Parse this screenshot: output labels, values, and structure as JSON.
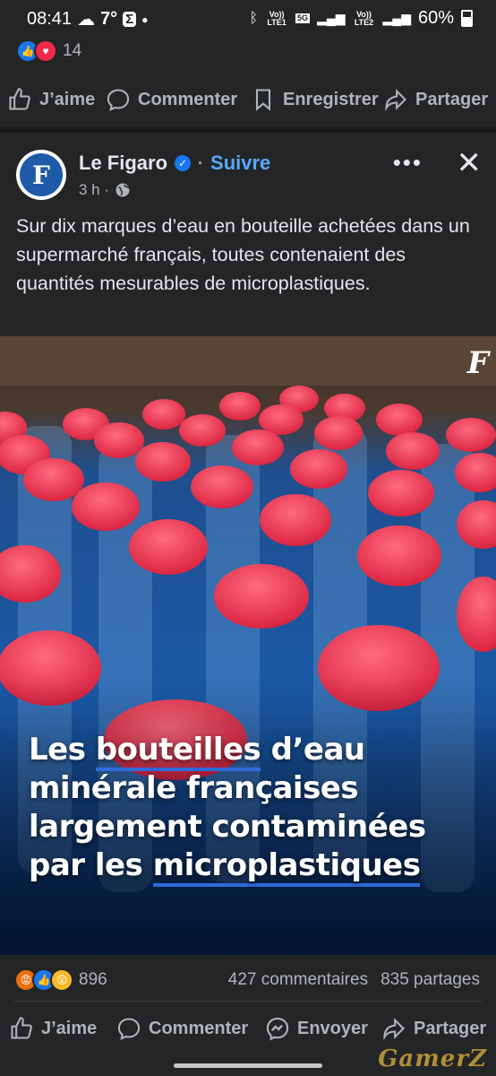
{
  "status_bar": {
    "time": "08:41",
    "temperature": "7°",
    "notif_icon": "Σ",
    "volte1": "Vo)) LTE1",
    "network": "5G",
    "volte2": "Vo)) LTE2",
    "battery": "60%"
  },
  "previous_post": {
    "reaction_count": "14",
    "actions": {
      "like": "J’aime",
      "comment": "Commenter",
      "save": "Enregistrer",
      "share": "Partager"
    }
  },
  "post": {
    "page_name": "Le Figaro",
    "follow_label": "Suivre",
    "time_ago": "3 h ·",
    "avatar_letter": "F",
    "text": "Sur dix marques d’eau en bouteille achetées dans un supermarché français, toutes contenaient des quantités mesurables de microplastiques.",
    "image": {
      "brand_mark": "F",
      "title_lines": [
        [
          "Les ",
          "bouteilles",
          " d’eau"
        ],
        [
          "minérale françaises"
        ],
        [
          "largement contaminées"
        ],
        [
          "par les ",
          "microplastiques"
        ]
      ],
      "title_l1_a": "Les ",
      "title_l1_b": "bouteilles",
      "title_l1_c": " d’eau",
      "title_l2": "minérale françaises",
      "title_l3": "largement contaminées",
      "title_l4_a": "par les ",
      "title_l4_b": "microplastiques"
    },
    "reaction_count": "896",
    "comments": "427 commentaires",
    "shares": "835 partages",
    "actions": {
      "like": "J’aime",
      "comment": "Commenter",
      "send": "Envoyer",
      "share": "Partager"
    }
  },
  "colors": {
    "background": "#242526",
    "accent": "#1877f2",
    "cap_red": "#e8324f",
    "water_blue": "#1b4d92"
  },
  "watermark": "GamerZ"
}
